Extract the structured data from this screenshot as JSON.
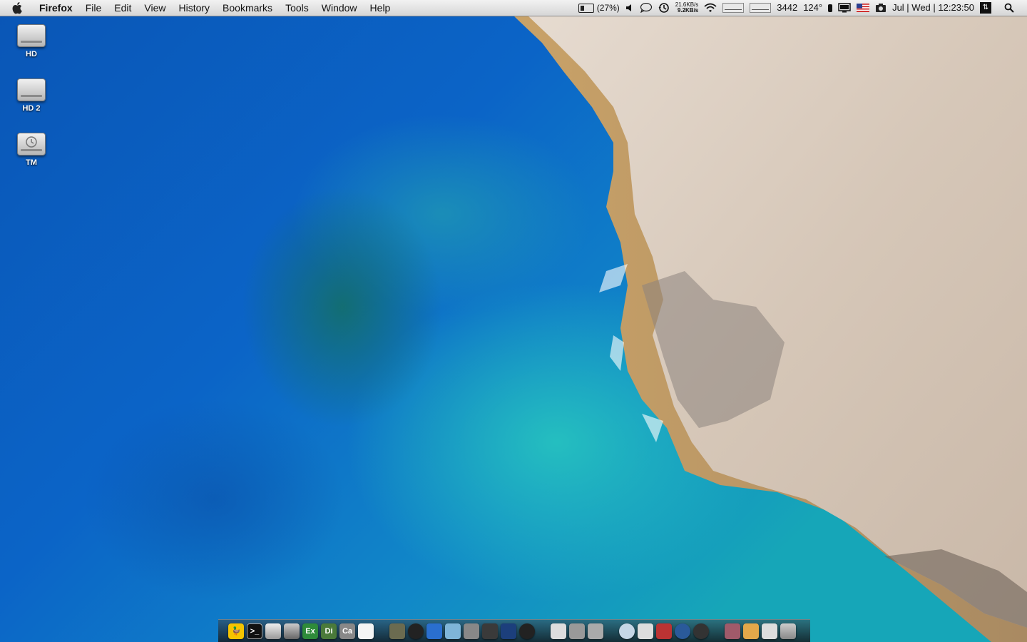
{
  "menubar": {
    "app_name": "Firefox",
    "menus": [
      "File",
      "Edit",
      "View",
      "History",
      "Bookmarks",
      "Tools",
      "Window",
      "Help"
    ],
    "status": {
      "battery": "(27%)",
      "net_up": "21.6KB/s",
      "net_down": "9.2KB/s",
      "count": "3442",
      "temperature": "124°",
      "clock": "Jul | Wed | 12:23:50"
    }
  },
  "desktop": {
    "icons": [
      {
        "label": "HD"
      },
      {
        "label": "HD 2"
      },
      {
        "label": "TM"
      }
    ]
  },
  "dock": {
    "text_icons": [
      "Ex",
      "Di",
      "Ca"
    ]
  },
  "colors": {
    "sea_deep": "#0a56b6",
    "sea_shallow": "#16a6b8",
    "cliff": "#dcd0c4",
    "menubar": "#e6e6e6"
  }
}
